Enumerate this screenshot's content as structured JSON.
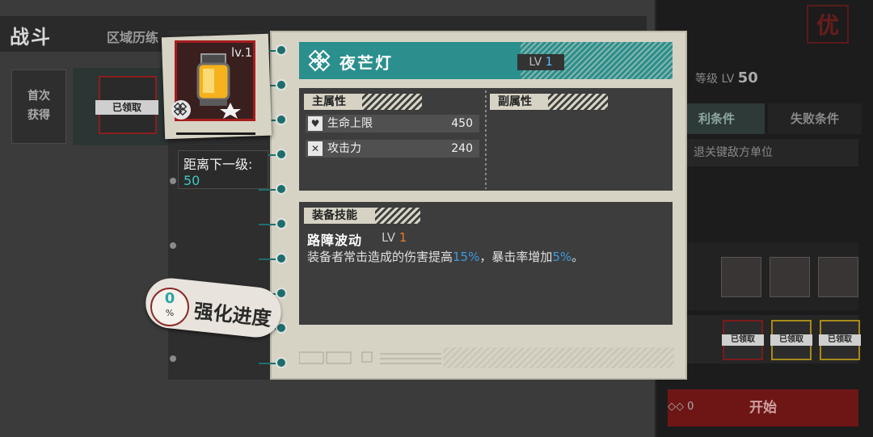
{
  "background": {
    "title": "战斗",
    "tab": "区域历练",
    "first_reward_label": "首次\n获得",
    "claimed_label": "已领取",
    "right_badge": "优",
    "level_label": "等级 LV",
    "level_value": "50",
    "win_tab": "利条件",
    "lose_tab": "失败条件",
    "condition_text": "退关键敌方单位",
    "reward_claimed": [
      "已领取",
      "已领取",
      "已领取"
    ],
    "start_button": "开始",
    "cost_value": "0"
  },
  "item_card": {
    "level_text": "lv.1",
    "next_level_label": "距离下一级:",
    "next_level_value": "50"
  },
  "progress": {
    "value": "0",
    "percent_sign": "%",
    "label": "强化进度"
  },
  "detail": {
    "name": "夜芒灯",
    "lv_label": "LV",
    "lv_value": "1",
    "main_attr_header": "主属性",
    "sub_attr_header": "副属性",
    "stats": [
      {
        "icon": "heart-shield-icon",
        "label": "生命上限",
        "value": "450"
      },
      {
        "icon": "crossed-swords-icon",
        "label": "攻击力",
        "value": "240"
      }
    ],
    "skill_header": "装备技能",
    "skill_name": "路障波动",
    "skill_lv_label": "LV",
    "skill_lv_value": "1",
    "skill_desc_pre": "装备者常击造成的伤害提高",
    "skill_desc_val1": "15%",
    "skill_desc_mid": "，暴击率增加",
    "skill_desc_val2": "5%",
    "skill_desc_post": "。"
  },
  "colors": {
    "accent_teal": "#2a8f8d",
    "value_cyan": "#3fc6c4",
    "highlight_blue": "#3b9be0",
    "level_orange": "#e57b2a",
    "border_red": "#a51d1d"
  }
}
